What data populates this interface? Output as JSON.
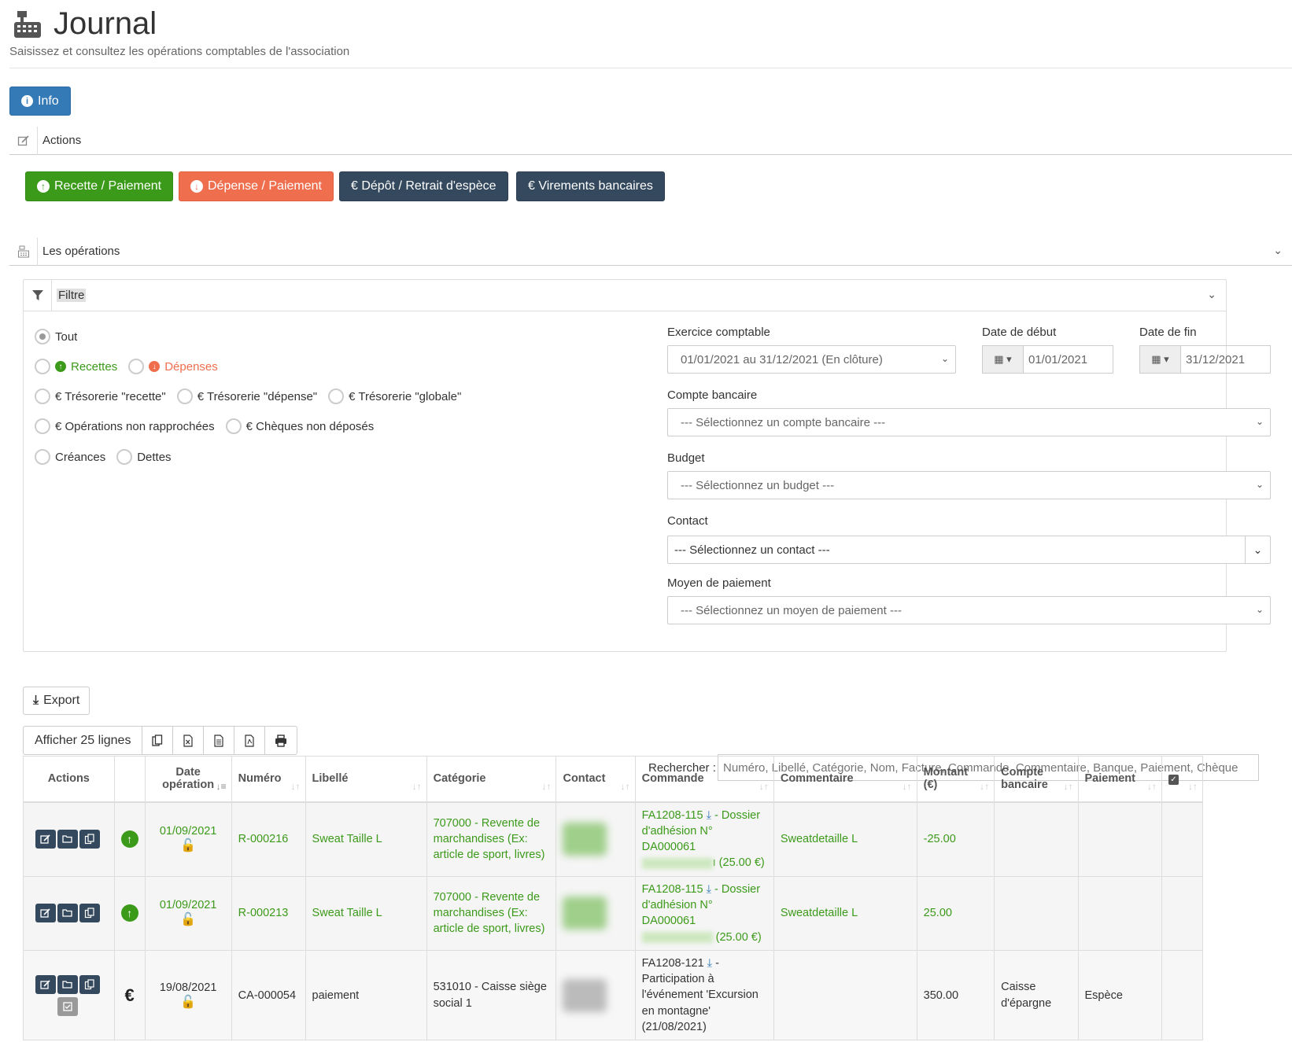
{
  "page": {
    "title": "Journal",
    "subtitle": "Saisissez et consultez les opérations comptables de l'association",
    "info_label": "Info"
  },
  "actions": {
    "header": "Actions",
    "recette": "Recette / Paiement",
    "depense": "Dépense / Paiement",
    "depot": "€ Dépôt / Retrait d'espèce",
    "virements": "€ Virements bancaires"
  },
  "operations": {
    "header": "Les opérations",
    "filter_title": "Filtre"
  },
  "filter": {
    "radios": {
      "tout": "Tout",
      "recettes": "Recettes",
      "depenses": "Dépenses",
      "treso_recette": "€ Trésorerie \"recette\"",
      "treso_depense": "€ Trésorerie \"dépense\"",
      "treso_globale": "€ Trésorerie \"globale\"",
      "non_rapprochees": "€ Opérations non rapprochées",
      "cheques": "€ Chèques non déposés",
      "creances": "Créances",
      "dettes": "Dettes"
    },
    "exercice_label": "Exercice comptable",
    "exercice_value": "01/01/2021 au 31/12/2021 (En clôture)",
    "date_debut_label": "Date de début",
    "date_debut_value": "01/01/2021",
    "date_fin_label": "Date de fin",
    "date_fin_value": "31/12/2021",
    "compte_label": "Compte bancaire",
    "compte_placeholder": "--- Sélectionnez un compte bancaire ---",
    "budget_label": "Budget",
    "budget_placeholder": "--- Sélectionnez un budget ---",
    "contact_label": "Contact",
    "contact_placeholder": "--- Sélectionnez un contact ---",
    "moyen_label": "Moyen de paiement",
    "moyen_placeholder": "--- Sélectionnez un moyen de paiement ---"
  },
  "toolbar": {
    "export": "Export",
    "afficher": "Afficher 25 lignes",
    "search_label": "Rechercher :",
    "search_placeholder": "Numéro, Libellé, Catégorie, Nom, Facture, Commande, Commentaire, Banque, Paiement, Chèque"
  },
  "table": {
    "headers": {
      "actions": "Actions",
      "date1": "Date",
      "date2": "opération",
      "numero": "Numéro",
      "libelle": "Libellé",
      "categorie": "Catégorie",
      "contact": "Contact",
      "commande": "Commande",
      "commentaire": "Commentaire",
      "montant1": "Montant",
      "montant2": "(€)",
      "compte1": "Compte",
      "compte2": "bancaire",
      "paiement": "Paiement"
    },
    "rows": [
      {
        "date": "01/09/2021",
        "numero": "R-000216",
        "libelle": "Sweat Taille L",
        "categorie": "707000 - Revente de marchandises (Ex: article de sport, livres)",
        "commande_ref": "FA1208-115",
        "commande_text": "- Dossier d'adhésion N° DA000061",
        "commande_tail": "ı (25.00 €)",
        "commentaire": "Sweatdetaille L",
        "montant": "-25.00",
        "compte": "",
        "paiement": ""
      },
      {
        "date": "01/09/2021",
        "numero": "R-000213",
        "libelle": "Sweat Taille L",
        "categorie": "707000 - Revente de marchandises (Ex: article de sport, livres)",
        "commande_ref": "FA1208-115",
        "commande_text": "- Dossier d'adhésion N° DA000061",
        "commande_tail": "(25.00 €)",
        "commentaire": "Sweatdetaille L",
        "montant": "25.00",
        "compte": "",
        "paiement": ""
      },
      {
        "date": "19/08/2021",
        "numero": "CA-000054",
        "libelle": "paiement",
        "categorie": "531010 - Caisse siège social 1",
        "commande_ref": "FA1208-121",
        "commande_text": "- Participation à l'événement 'Excursion en montagne' (21/08/2021)",
        "commande_tail": "",
        "commentaire": "",
        "montant": "350.00",
        "compte": "Caisse d'épargne",
        "paiement": "Espèce"
      }
    ]
  },
  "colors": {
    "green": "#3c9a1a",
    "orange": "#ef6e4e",
    "dark": "#34495e",
    "info": "#337ab7"
  }
}
